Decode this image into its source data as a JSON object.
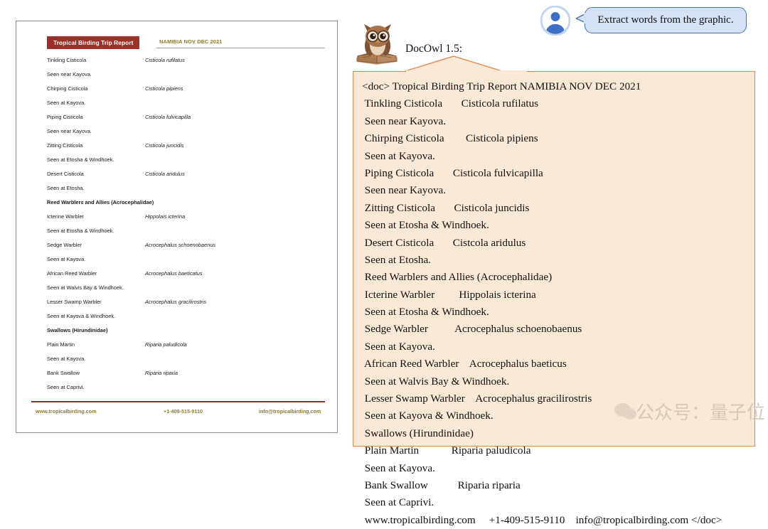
{
  "document": {
    "title_badge": "Tropical Birding Trip Report",
    "subtitle": "NAMIBIA NOV DEC 2021",
    "accent_color": "#9d3029",
    "subtitle_color": "#8a7c2c",
    "entries": [
      {
        "type": "species",
        "common": "Tinkling Cisticola",
        "scientific": "Cisticola rufilatus"
      },
      {
        "type": "note",
        "text": "Seen near Kayova."
      },
      {
        "type": "species",
        "common": "Chirping Cisticola",
        "scientific": "Cisticola pipiens"
      },
      {
        "type": "note",
        "text": "Seen at Kayova."
      },
      {
        "type": "species",
        "common": "Piping Cisticola",
        "scientific": "Cisticola fulvicapilla"
      },
      {
        "type": "note",
        "text": "Seen near Kayova."
      },
      {
        "type": "species",
        "common": "Zitting Cisticola",
        "scientific": "Cisticola juncidis"
      },
      {
        "type": "note",
        "text": "Seen at Etosha & Windhoek."
      },
      {
        "type": "species",
        "common": "Desert Cisticola",
        "scientific": "Cisticola aridulus"
      },
      {
        "type": "note",
        "text": "Seen at Etosha."
      },
      {
        "type": "heading",
        "common": "Reed Warblers and Allies (Acrocephalidae)",
        "scientific": ""
      },
      {
        "type": "species",
        "common": "Icterine Warbler",
        "scientific": "Hippolais icterina"
      },
      {
        "type": "note",
        "text": "Seen at Etosha & Windhoek."
      },
      {
        "type": "species",
        "common": "Sedge Warbler",
        "scientific": "Acrocephalus schoenobaenus"
      },
      {
        "type": "note",
        "text": "Seen at Kayova."
      },
      {
        "type": "species",
        "common": "African Reed Warbler",
        "scientific": "Acrocephalus baeticatus"
      },
      {
        "type": "note",
        "text": "Seen at Walvis Bay & Windhoek."
      },
      {
        "type": "species",
        "common": "Lesser Swamp Warbler",
        "scientific": "Acrocephalus gracilirostris"
      },
      {
        "type": "note",
        "text": "Seen at Kayova & Windhoek."
      },
      {
        "type": "heading",
        "common": "Swallows (Hirundinidae)",
        "scientific": ""
      },
      {
        "type": "species",
        "common": "Plain Martin",
        "scientific": "Riparia paludicola"
      },
      {
        "type": "note",
        "text": "Seen at Kayova."
      },
      {
        "type": "species",
        "common": "Bank Swallow",
        "scientific": "Riparia riparia"
      },
      {
        "type": "note",
        "text": "Seen at Caprivi."
      }
    ],
    "footer": {
      "website": "www.tropicalbirding.com",
      "phone": "+1-409-515-9110",
      "email": "info@tropicalbirding.com"
    }
  },
  "conversation": {
    "user": {
      "avatar_icon": "user-avatar-icon",
      "message": "Extract words from the graphic."
    },
    "assistant": {
      "avatar_icon": "owl-icon",
      "name": "DocOwl 1.5:",
      "answer_lines": [
        "<doc> Tropical Birding Trip Report NAMIBIA NOV DEC 2021",
        " Tinkling Cisticola       Cisticola rufilatus",
        " Seen near Kayova.",
        " Chirping Cisticola        Cisticola pipiens",
        " Seen at Kayova.",
        " Piping Cisticola       Cisticola fulvicapilla",
        " Seen near Kayova.",
        " Zitting Cisticola       Cisticola juncidis",
        " Seen at Etosha & Windhoek.",
        " Desert Cisticola       Cistcola aridulus",
        " Seen at Etosha.",
        " Reed Warblers and Allies (Acrocephalidae)",
        " Icterine Warbler         Hippolais icterina",
        " Seen at Etosha & Windhoek.",
        " Sedge Warbler          Acrocephalus schoenobaenus",
        " Seen at Kayova.",
        " African Reed Warbler    Acrocephalus baeticus",
        " Seen at Walvis Bay & Windhoek.",
        " Lesser Swamp Warbler    Acrocephalus gracilirostris",
        " Seen at Kayova & Windhoek.",
        " Swallows (Hirundinidae)",
        " Plain Martin            Riparia paludicola",
        " Seen at Kayova.",
        " Bank Swallow           Riparia riparia",
        " Seen at Caprivi.",
        " www.tropicalbirding.com     +1-409-515-9110    info@tropicalbirding.com </doc>"
      ],
      "panel_bg_color": "#fbe9d8",
      "panel_border_color": "#e2894a"
    }
  },
  "watermark": {
    "text": "公众号：量子位",
    "logo_icon": "wechat-icon"
  }
}
